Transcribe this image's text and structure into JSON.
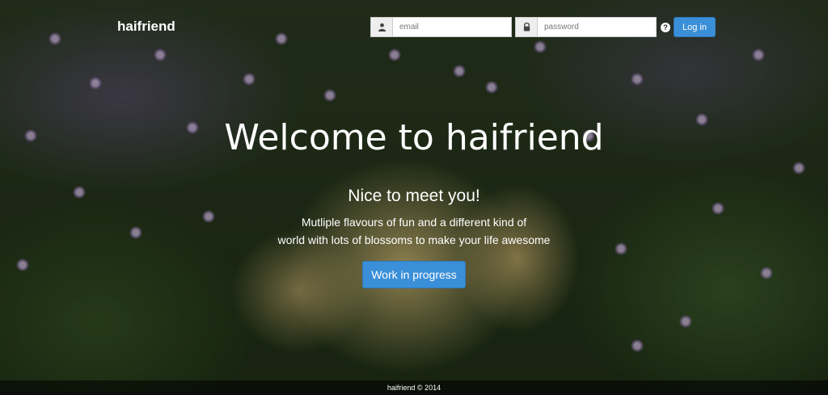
{
  "brand": "haifriend",
  "login": {
    "email_placeholder": "email",
    "password_placeholder": "password",
    "help_icon": "?",
    "button_label": "Log in"
  },
  "hero": {
    "title": "Welcome to haifriend",
    "subtitle": "Nice to meet you!",
    "description_line1": "Mutliple flavours of fun and a different kind of",
    "description_line2": "world with lots of blossoms to make your life awesome",
    "cta_label": "Work in progress"
  },
  "footer": {
    "text": "haifriend © 2014"
  },
  "colors": {
    "accent": "#3a8fd8",
    "background": "#26361c"
  },
  "icons": {
    "email": "user-icon",
    "password": "lock-icon"
  }
}
